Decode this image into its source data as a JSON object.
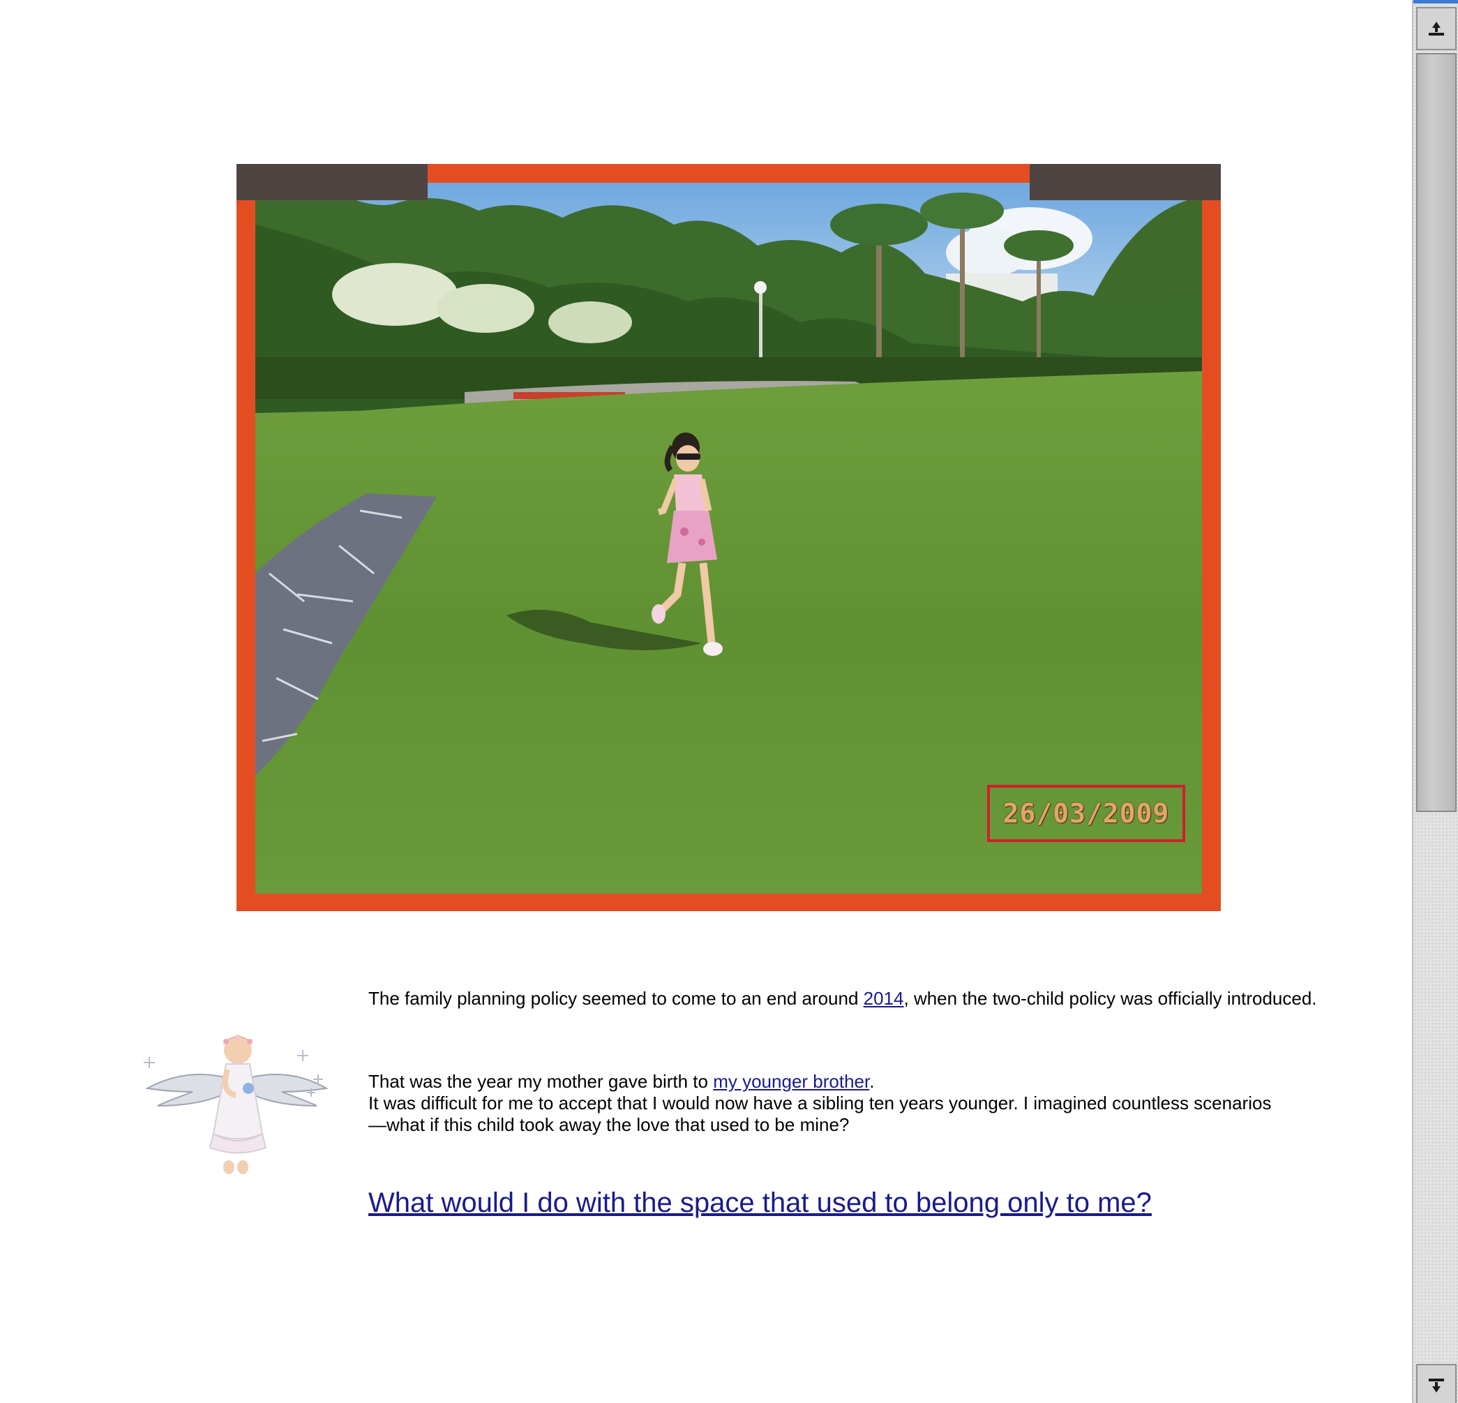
{
  "photo": {
    "date_stamp": "26/03/2009",
    "frame_color": "#e44d22",
    "tab_color": "#4e4542",
    "stamp_border_color": "#d11f2c"
  },
  "story": {
    "para1": {
      "before": "The family planning policy seemed to come to an end around ",
      "link": "2014",
      "after": ", when the two-child policy was officially introduced."
    },
    "para2": {
      "before": "That was the year my mother gave birth to ",
      "link": "my younger brother",
      "after": ".",
      "line2": "It was difficult for me to accept that I would now have a sibling ten years younger. I imagined countless scenarios",
      "line3": "—what if this child took away the love that used to be mine?"
    },
    "question": "What would I do with the space that used to belong only to me?"
  },
  "decor": {
    "angel_icon": "angel-icon"
  },
  "colors": {
    "link": "#1a1a8c",
    "text": "#000000"
  }
}
